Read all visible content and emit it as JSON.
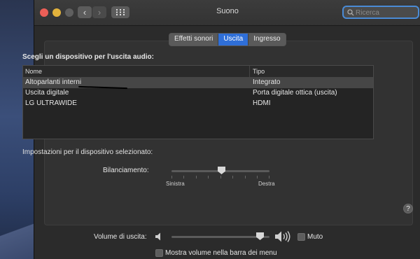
{
  "window": {
    "title": "Suono",
    "nav_back": "‹",
    "nav_forward": "›"
  },
  "search": {
    "placeholder": "Ricerca",
    "value": ""
  },
  "tabs": [
    {
      "label": "Effetti sonori",
      "active": false
    },
    {
      "label": "Uscita",
      "active": true
    },
    {
      "label": "Ingresso",
      "active": false
    }
  ],
  "output": {
    "heading": "Scegli un dispositivo per l'uscita audio:",
    "columns": {
      "name": "Nome",
      "type": "Tipo"
    },
    "devices": [
      {
        "name": "Altoparlanti interni",
        "type": "Integrato",
        "selected": true
      },
      {
        "name": "Uscita digitale",
        "type": "Porta digitale ottica (uscita)",
        "selected": false
      },
      {
        "name": "LG ULTRAWIDE",
        "type": "HDMI",
        "selected": false
      }
    ]
  },
  "device_settings": {
    "heading": "Impostazioni per il dispositivo selezionato:",
    "balance_label": "Bilanciamento:",
    "balance_left": "Sinistra",
    "balance_right": "Destra",
    "balance_value": 0.5
  },
  "help": {
    "label": "?"
  },
  "volume": {
    "label": "Volume di uscita:",
    "value": 0.9,
    "mute_label": "Muto",
    "mute_checked": false,
    "show_in_menubar_label": "Mostra volume nella barra dei menu",
    "show_in_menubar_checked": false
  },
  "colors": {
    "accent": "#2f6fd8",
    "close": "#ec5f57",
    "minimize": "#e3b33c"
  }
}
